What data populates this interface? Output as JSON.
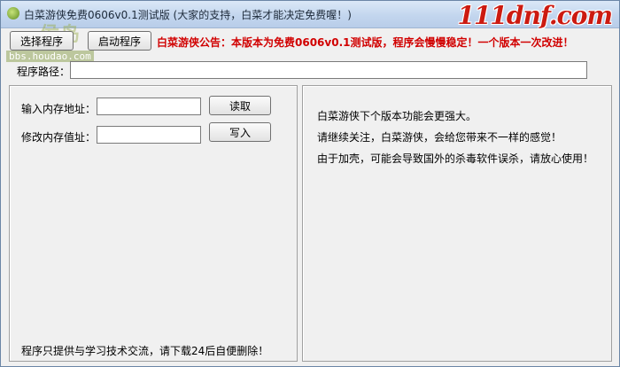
{
  "window": {
    "title": "白菜游侠免费0606v0.1测试版 (大家的支持，白菜才能决定免费喔！)",
    "brand": "111dnf.com",
    "watermark_url": "bbs.houdao.com",
    "watermark_badge": "侯岛"
  },
  "toolbar": {
    "select_label": "选择程序",
    "start_label": "启动程序",
    "notice": "白菜游侠公告：本版本为免费0606v0.1测试版，程序会慢慢稳定！一个版本一次改进！"
  },
  "path": {
    "label": "程序路径：",
    "value": ""
  },
  "memory": {
    "read_address_label": "输入内存地址：",
    "read_address_value": "",
    "read_button": "读取",
    "write_value_label": "修改内存值址：",
    "write_value_value": "",
    "write_button": "写入",
    "footer": "程序只提供与学习技术交流，请下载24后自便删除！"
  },
  "info": {
    "lines": [
      "白菜游侠下个版本功能会更强大。",
      "请继续关注，白菜游侠，会给您带来不一样的感觉！",
      "由于加壳，可能会导致国外的杀毒软件误杀，请放心使用！"
    ]
  },
  "colors": {
    "notice": "#d10000",
    "brand": "#cc1a10",
    "window_bg": "#f0f0f0"
  }
}
